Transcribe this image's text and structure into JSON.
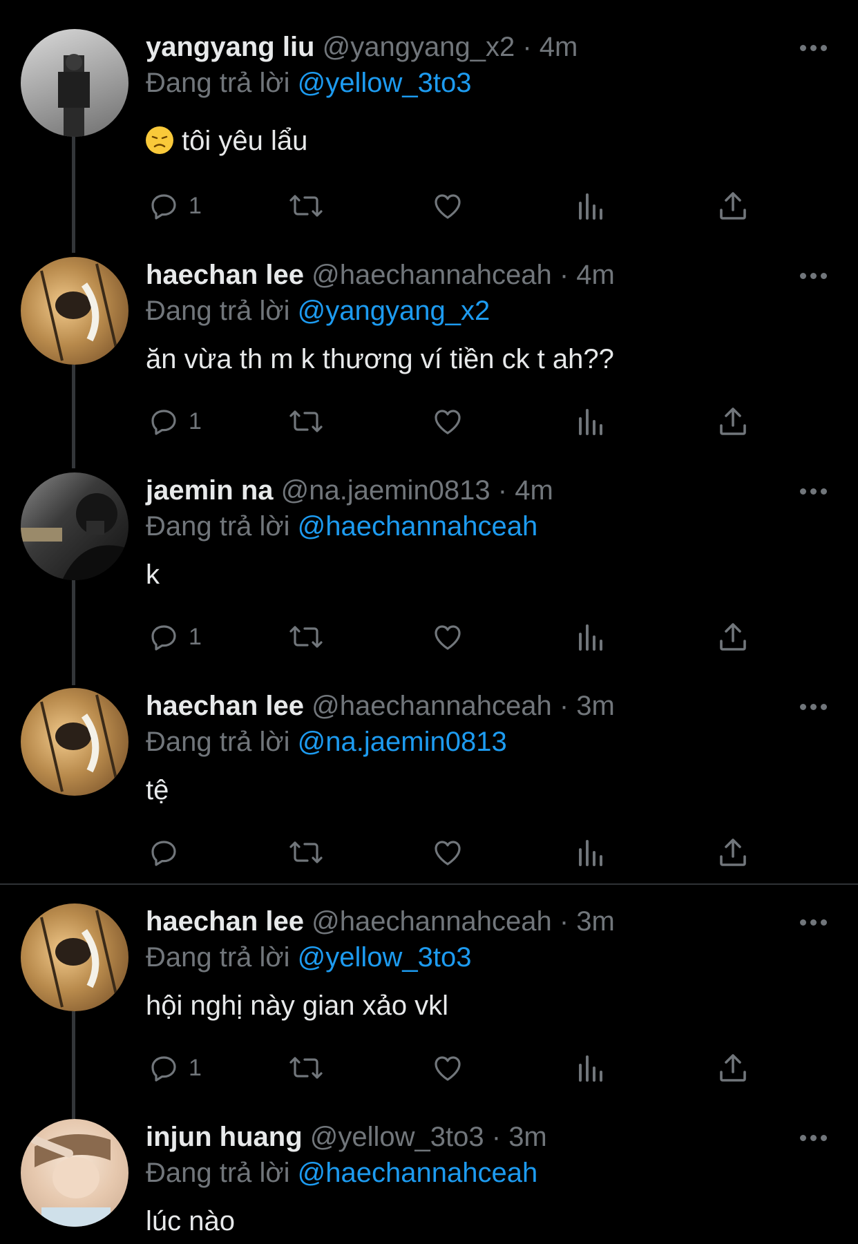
{
  "replying_label": "Đang trả lời",
  "tweets": [
    {
      "name": "yangyang liu",
      "handle": "@yangyang_x2",
      "time": "4m",
      "reply_to": "@yellow_3to3",
      "emoji_icon": "disappointed-face-emoji",
      "text": "tôi yêu lẩu",
      "reply_count": "1"
    },
    {
      "name": "haechan lee",
      "handle": "@haechannahceah",
      "time": "4m",
      "reply_to": "@yangyang_x2",
      "text": "ăn vừa th m k thương ví tiền ck t ah??",
      "reply_count": "1"
    },
    {
      "name": "jaemin na",
      "handle": "@na.jaemin0813",
      "time": "4m",
      "reply_to": "@haechannahceah",
      "text": "k",
      "reply_count": "1"
    },
    {
      "name": "haechan lee",
      "handle": "@haechannahceah",
      "time": "3m",
      "reply_to": "@na.jaemin0813",
      "text": "tệ",
      "reply_count": ""
    },
    {
      "name": "haechan lee",
      "handle": "@haechannahceah",
      "time": "3m",
      "reply_to": "@yellow_3to3",
      "text": "hội nghị này gian xảo vkl",
      "reply_count": "1"
    },
    {
      "name": "injun huang",
      "handle": "@yellow_3to3",
      "time": "3m",
      "reply_to": "@haechannahceah",
      "text": "lúc nào",
      "reply_count": ""
    }
  ],
  "colors": {
    "background": "#000000",
    "text": "#e7e9ea",
    "secondary": "#71767b",
    "mention": "#1d9bf0"
  }
}
